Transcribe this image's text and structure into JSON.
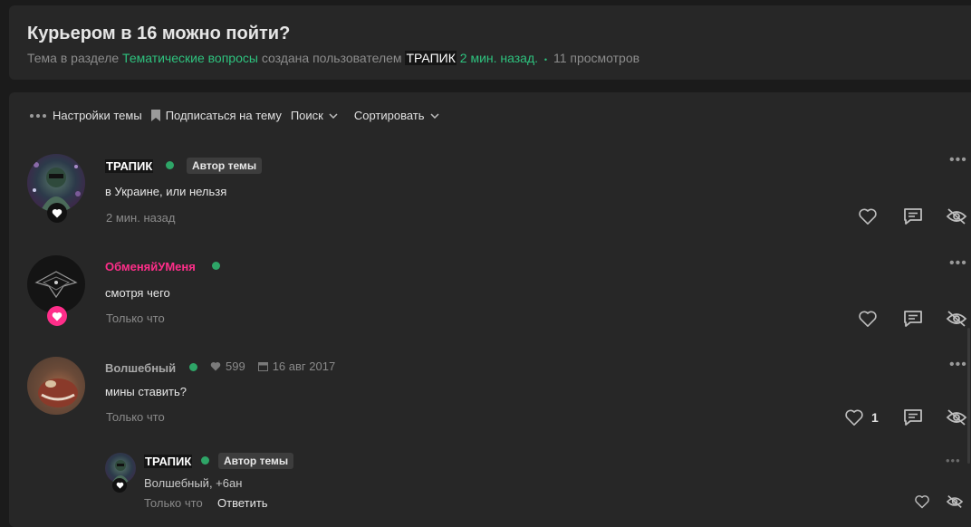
{
  "header": {
    "title": "Курьером в 16 можно пойти?",
    "meta_prefix": "Тема в разделе",
    "section_link": "Тематические вопросы",
    "meta_mid": "создана пользователем",
    "author": "ТРАПИК",
    "created_ago": "2 мин. назад.",
    "separator": "•",
    "views": "11 просмотров"
  },
  "toolbar": {
    "settings_label": "Настройки темы",
    "subscribe_label": "Подписаться на тему",
    "search_label": "Поиск",
    "sort_label": "Сортировать"
  },
  "posts": [
    {
      "username": "ТРАПИК",
      "username_color": "#ffffff",
      "tag": "Автор темы",
      "text": "в Украине, или нельзя",
      "time": "2 мин. назад"
    },
    {
      "username": "ОбменяйУМеня",
      "username_color": "#ff2e8a",
      "text": "смотря чего",
      "time": "Только что"
    },
    {
      "username": "Волшебный",
      "username_color": "#a8a8a8",
      "likes": "599",
      "reg_date": "16 авг 2017",
      "text": "мины ставить?",
      "time": "Только что",
      "like_count": "1"
    }
  ],
  "reply": {
    "username": "ТРАПИК",
    "tag": "Автор темы",
    "text": "Волшебный, +6ан",
    "time": "Только что",
    "reply_label": "Ответить"
  },
  "colors": {
    "accent_green": "#2ec27e",
    "online": "#2ea567",
    "pink": "#ff2e8a"
  },
  "icons": [
    "more-dots-icon",
    "bookmark-icon",
    "chevron-down-icon",
    "heart-icon",
    "comment-icon",
    "eye-slash-icon",
    "calendar-icon"
  ]
}
